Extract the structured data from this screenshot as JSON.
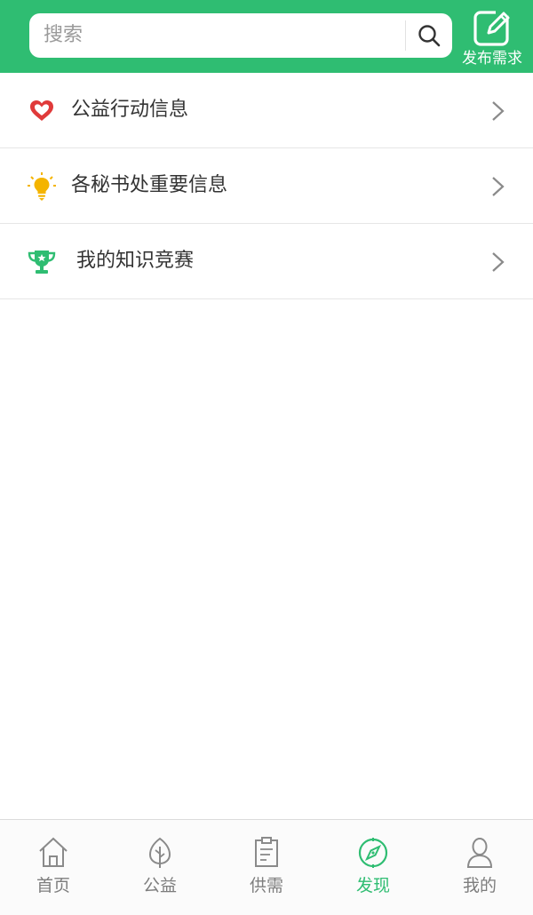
{
  "header": {
    "search_placeholder": "搜索",
    "publish_label": "发布需求",
    "accent_color": "#2fbd72"
  },
  "list": {
    "items": [
      {
        "label": "公益行动信息",
        "icon": "heart-icon"
      },
      {
        "label": "各秘书处重要信息",
        "icon": "lightbulb-icon"
      },
      {
        "label": "我的知识竞赛",
        "icon": "trophy-icon"
      }
    ]
  },
  "tabbar": {
    "items": [
      {
        "label": "首页",
        "icon": "home-icon",
        "active": false
      },
      {
        "label": "公益",
        "icon": "leaf-icon",
        "active": false
      },
      {
        "label": "供需",
        "icon": "document-icon",
        "active": false
      },
      {
        "label": "发现",
        "icon": "compass-icon",
        "active": true
      },
      {
        "label": "我的",
        "icon": "user-icon",
        "active": false
      }
    ]
  }
}
